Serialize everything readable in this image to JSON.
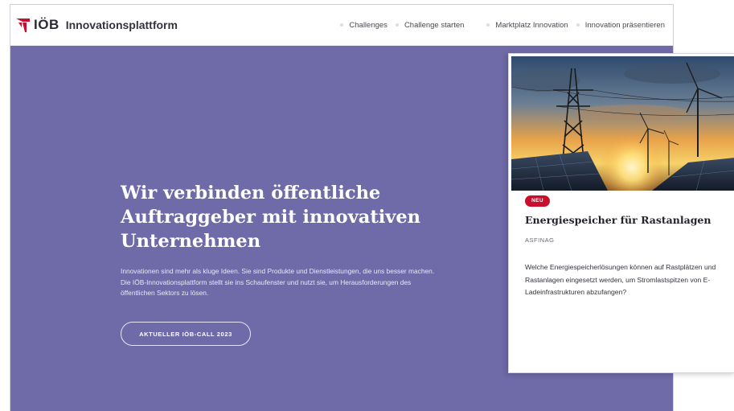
{
  "header": {
    "brand": "IÖB",
    "subtitle": "Innovationsplattform",
    "nav": [
      {
        "label": "Challenges"
      },
      {
        "label": "Challenge starten"
      },
      {
        "label": "Marktplatz Innovation"
      },
      {
        "label": "Innovation präsentieren"
      }
    ]
  },
  "hero": {
    "title": "Wir verbinden öffentliche Auftraggeber mit innovativen Unternehmen",
    "text": "Innovationen sind mehr als kluge Ideen. Sie sind Produkte und Dienstleistungen, die uns besser machen. Die IÖB-Innovationsplattform stellt sie ins Schaufenster und nutzt sie, um Herausforderungen des öffentlichen Sektors zu lösen.",
    "cta_label": "AKTUELLER IÖB-CALL 2023",
    "background_color": "#6f6aa8"
  },
  "card": {
    "image_icon": "energy-landscape-image",
    "badge": "NEU",
    "badge_color": "#c8102e",
    "title": "Energiespeicher für Rastanlagen",
    "org": "ASFINAG",
    "description": "Welche Energiespeicherlösungen können auf Rastplätzen und Rastanlagen eingesetzt werden, um Stromlastspitzen von E-Ladeinfrastrukturen abzufangen?"
  }
}
